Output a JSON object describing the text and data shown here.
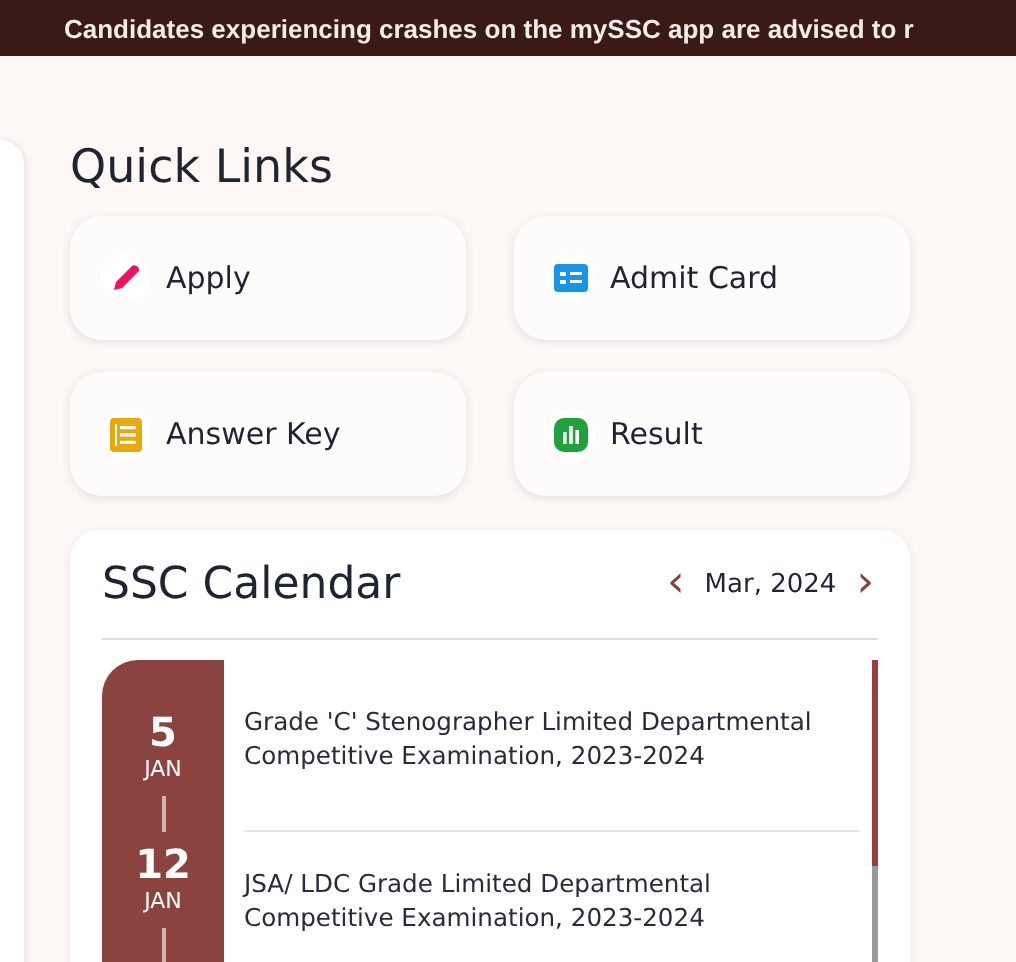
{
  "banner": {
    "text": "Candidates experiencing crashes on the mySSC app are advised to r"
  },
  "quick_links": {
    "title": "Quick Links",
    "items": [
      {
        "label": "Apply",
        "kind": "apply"
      },
      {
        "label": "Admit Card",
        "kind": "admit"
      },
      {
        "label": "Answer Key",
        "kind": "key"
      },
      {
        "label": "Result",
        "kind": "result"
      }
    ]
  },
  "calendar": {
    "title": "SSC Calendar",
    "prev": "‹",
    "month": "Mar, 2024",
    "next": "›",
    "events": [
      {
        "day": "5",
        "month": "JAN",
        "title": "Grade 'C' Stenographer Limited Departmental Competitive Examination, 2023-2024"
      },
      {
        "day": "12",
        "month": "JAN",
        "title": "JSA/ LDC Grade Limited Departmental Competitive Examination, 2023-2024"
      }
    ]
  }
}
